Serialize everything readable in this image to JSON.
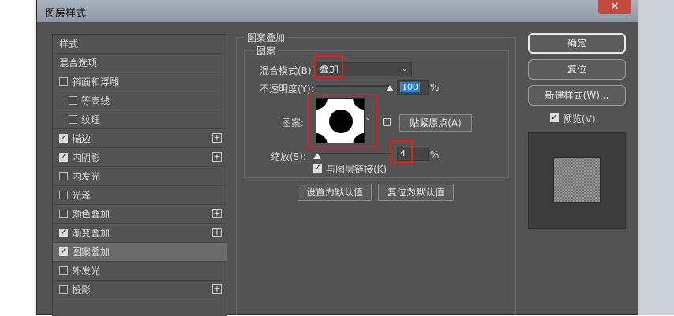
{
  "dialog": {
    "title": "图层样式",
    "close_glyph": "✕"
  },
  "sidebar": {
    "items": [
      {
        "label": "样式",
        "checkbox": false,
        "checked": false,
        "plus": false,
        "selected": false
      },
      {
        "label": "混合选项",
        "checkbox": false,
        "checked": false,
        "plus": false,
        "selected": false
      },
      {
        "label": "斜面和浮雕",
        "checkbox": true,
        "checked": false,
        "plus": false,
        "selected": false
      },
      {
        "label": "等高线",
        "checkbox": true,
        "checked": false,
        "plus": false,
        "selected": false
      },
      {
        "label": "纹理",
        "checkbox": true,
        "checked": false,
        "plus": false,
        "selected": false
      },
      {
        "label": "描边",
        "checkbox": true,
        "checked": true,
        "plus": true,
        "selected": false
      },
      {
        "label": "内阴影",
        "checkbox": true,
        "checked": true,
        "plus": true,
        "selected": false
      },
      {
        "label": "内发光",
        "checkbox": true,
        "checked": false,
        "plus": false,
        "selected": false
      },
      {
        "label": "光泽",
        "checkbox": true,
        "checked": false,
        "plus": false,
        "selected": false
      },
      {
        "label": "颜色叠加",
        "checkbox": true,
        "checked": false,
        "plus": true,
        "selected": false
      },
      {
        "label": "渐变叠加",
        "checkbox": true,
        "checked": true,
        "plus": true,
        "selected": false
      },
      {
        "label": "图案叠加",
        "checkbox": true,
        "checked": true,
        "plus": false,
        "selected": true
      },
      {
        "label": "外发光",
        "checkbox": true,
        "checked": false,
        "plus": false,
        "selected": false
      },
      {
        "label": "投影",
        "checkbox": true,
        "checked": false,
        "plus": true,
        "selected": false
      }
    ],
    "plus_glyph": "+",
    "check_glyph": "✓"
  },
  "panel": {
    "section_title": "图案叠加",
    "group_title": "图案",
    "blend_mode_label": "混合模式(B):",
    "blend_mode_value": "叠加",
    "opacity_label": "不透明度(Y):",
    "opacity_value": "100",
    "opacity_unit": "%",
    "opacity_fraction": 1.0,
    "pattern_label": "图案:",
    "snap_origin_button": "贴紧原点(A)",
    "scale_label": "缩放(S):",
    "scale_value": "4",
    "scale_unit": "%",
    "link_label": "与图层链接(K)",
    "link_checked": true,
    "set_default_button": "设置为默认值",
    "reset_default_button": "复位为默认值"
  },
  "actions": {
    "ok_button": "确定",
    "reset_button": "复位",
    "new_style_button": "新建样式(W)...",
    "preview_label": "预览(V)",
    "preview_checked": true
  },
  "colors": {
    "dialog_bg": "#535353",
    "highlight": "#e02020",
    "selection": "#2d7fd0"
  }
}
